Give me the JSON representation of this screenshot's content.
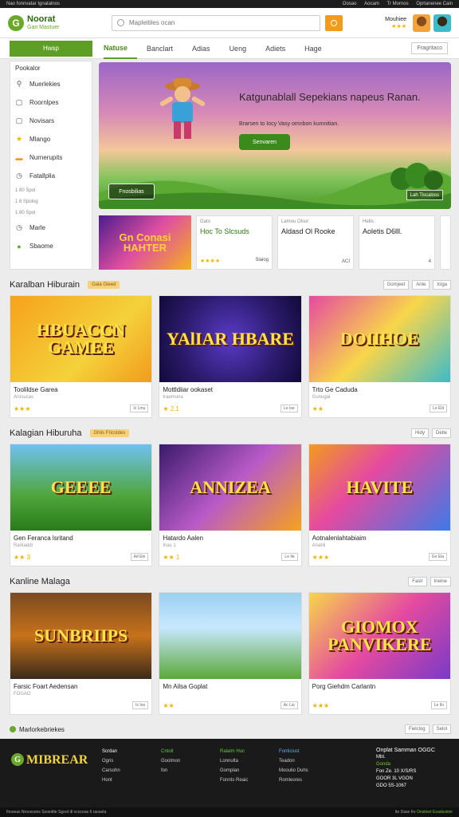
{
  "topstrip": {
    "left": "Nao fonnvatar Ignatalnos",
    "right": [
      "Oosao",
      "Aocam",
      "Tr Mornos",
      "Oprtanenee Cain"
    ]
  },
  "header": {
    "logo_line1": "Noorat",
    "logo_line2": "Gan Mastuer",
    "search_placeholder": "Mapleitiles ocan",
    "user_name": "Mouhiee",
    "user_rating": "★★★"
  },
  "nav": {
    "home_label": "Hwsp",
    "tabs": [
      "Natuse",
      "Banclart",
      "Adias",
      "Ueng",
      "Adiets",
      "Hage"
    ],
    "active_tab": "Natuse",
    "right_label": "Fragritaco"
  },
  "sidebar": {
    "title": "Pookalor",
    "items": [
      {
        "icon": "search-icon",
        "glyph": "⚲",
        "label": "Muerlekies"
      },
      {
        "icon": "box-icon",
        "glyph": "▢",
        "label": "Roornlpes"
      },
      {
        "icon": "box-icon",
        "glyph": "▢",
        "label": "Novisars"
      },
      {
        "icon": "star-icon",
        "glyph": "★",
        "label": "Mlango"
      },
      {
        "icon": "folder-icon",
        "glyph": "▬",
        "label": "Nurnerupits"
      },
      {
        "icon": "clock-icon",
        "glyph": "◷",
        "label": "Fatallplia"
      }
    ],
    "small": [
      "1 80 Spol",
      "1 8 Spolog",
      "1 80 Spol"
    ],
    "bottom_items": [
      {
        "icon": "clock-icon",
        "glyph": "◷",
        "label": "Marle"
      },
      {
        "icon": "circle-icon",
        "glyph": "●",
        "label": "Sbaome"
      }
    ]
  },
  "hero": {
    "title": "Katgunablall Sepekians napeus Ranan.",
    "subtitle": "Brarsen to Iocy Vasy omnbon kumnitian.",
    "button": "Senvaren",
    "secondary_button": "Fnosbilias",
    "corner_button": "Lah Tiscaloss"
  },
  "minis": [
    {
      "type": "img",
      "title": "Gn Conasi HAHTER"
    },
    {
      "tag": "Gato",
      "title": "Hoc To Slcsuds",
      "rating": "★★★★",
      "meta": "Slaiog"
    },
    {
      "tag": "Lamou Olsor",
      "title": "Aldasd Ol Rooke",
      "rating": "",
      "meta": "ACI"
    },
    {
      "tag": "Hebs",
      "title": "Aoletis D6lll.",
      "rating": "",
      "meta": "4"
    }
  ],
  "sections": [
    {
      "title": "Karalban Hiburain",
      "badge": "Gala Gieed",
      "tools": [
        "Gomjeet",
        "Anle",
        "Iciga"
      ],
      "cards": [
        {
          "art": "HBUACCN GAMEE",
          "name": "Toolildse Garea",
          "sub": "Arosucas",
          "rating": "★★★",
          "btn": "Ic Lmu"
        },
        {
          "art": "YAlIAR HBARE",
          "name": "Mottldiiar ookaset",
          "sub": "Iraemuna",
          "rating": "★ 2.1",
          "btn": "Le Ise"
        },
        {
          "art": "DOIIHOE",
          "name": "Trto Ge Caduda",
          "sub": "Gunugal",
          "rating": "★★",
          "btn": "Le Elit"
        }
      ]
    },
    {
      "title": "Kalagian Hiburuha",
      "badge": "Ghiis Fricstdes",
      "tools": [
        "Hidy",
        "Detle"
      ],
      "cards": [
        {
          "art": "GEEEE",
          "name": "Gen Feranca lsritand",
          "sub": "Rarkaddi",
          "rating": "★★ 3",
          "btn": "Ad Ele"
        },
        {
          "art": "ANNIZEA",
          "name": "Hatardo Aalen",
          "sub": "Inas 1",
          "rating": "★★ 1",
          "btn": "Le Ile"
        },
        {
          "art": "HAVITE",
          "name": "Aotnalenlahtabiaim",
          "sub": "Anahil",
          "rating": "★★★",
          "btn": "Go Ela"
        }
      ]
    },
    {
      "title": "Kanline Malaga",
      "badge": "",
      "tools": [
        "Faslr",
        "Inelne"
      ],
      "cards": [
        {
          "art": "SUNBRIIPS",
          "name": "Farsic Foart Aedensan",
          "sub": "FOGAG",
          "rating": "",
          "btn": "Ic Ino"
        },
        {
          "art": "",
          "name": "Mn Ailsa Goplat",
          "sub": "",
          "rating": "★★",
          "btn": "Ac Lio"
        },
        {
          "art": "GIOMOX PANVIKERE",
          "name": "Porg Giehdm Carlantn",
          "sub": "",
          "rating": "★★★",
          "btn": "Le Ilo"
        }
      ]
    }
  ],
  "recent": {
    "title": "Marlorkebriekes",
    "tools": [
      "Fielclog",
      "Selol"
    ]
  },
  "footer": {
    "logo": "MIBREAR",
    "cols": [
      {
        "head": "Scrdan",
        "items": [
          "Ogris",
          "Carsohn",
          "Hont"
        ]
      },
      {
        "head": "Cntoit",
        "items": [
          "Goolmon",
          "fon"
        ]
      },
      {
        "head": "Ralaim Huc",
        "items": [
          "Lonnulta",
          "Gomplan",
          "Fonnts Reaic"
        ]
      },
      {
        "head": "Fonticiust",
        "items": [
          "Teadon",
          "Mooulio Duhs",
          "Romleores"
        ]
      }
    ],
    "contact": [
      "Onplat Samman OGGC",
      "Mbt.",
      "Gonda",
      "Fon Ze. 10 X/S/RS",
      "GOOR 3L VGON",
      "GDO 5S-1067"
    ]
  },
  "bottombar": {
    "left": "Ihoseas Nrocesons Ssoedite Sgsrd dl vcocoas 6 raoasta",
    "right_a": "Ite Dase fro",
    "right_b": "Onstinet",
    "right_c": "Eoadsotinir"
  },
  "colors": {
    "accent": "#5e9e25",
    "orange": "#f29b1d",
    "footer_bg": "#1a1a1a"
  }
}
